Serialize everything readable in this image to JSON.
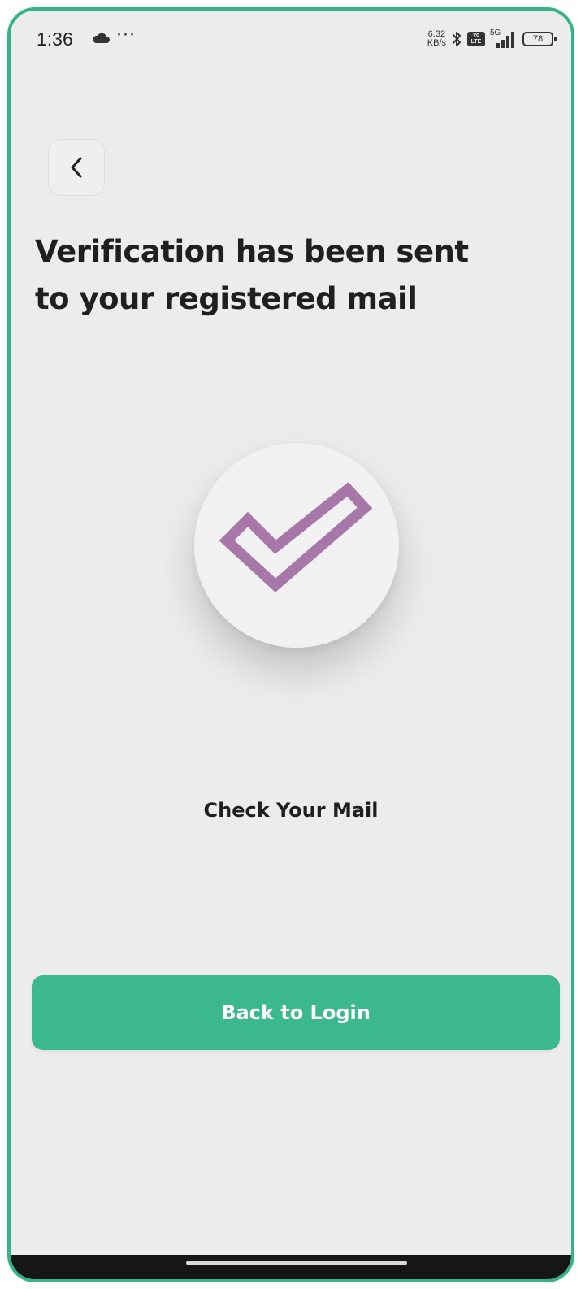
{
  "status_bar": {
    "time": "1:36",
    "more_indicator": "···",
    "net_speed_value": "6.32",
    "net_speed_unit": "KB/s",
    "volte_top": "Vo",
    "volte_bottom": "LTE",
    "network_type": "5G",
    "battery_level": "78"
  },
  "screen": {
    "title": "Verification has been sent to your registered mail",
    "caption": "Check Your Mail",
    "primary_button_label": "Back to Login"
  },
  "icons": {
    "back": "chevron-left-icon",
    "success": "checkmark-icon",
    "cloud": "cloud-icon",
    "bluetooth": "bluetooth-icon",
    "signal": "signal-icon",
    "battery": "battery-icon"
  },
  "colors": {
    "accent": "#3cb88f",
    "frame_border": "#34b38a",
    "checkmark": "#a877a9",
    "background": "#ececec",
    "text": "#1f1f1f"
  }
}
